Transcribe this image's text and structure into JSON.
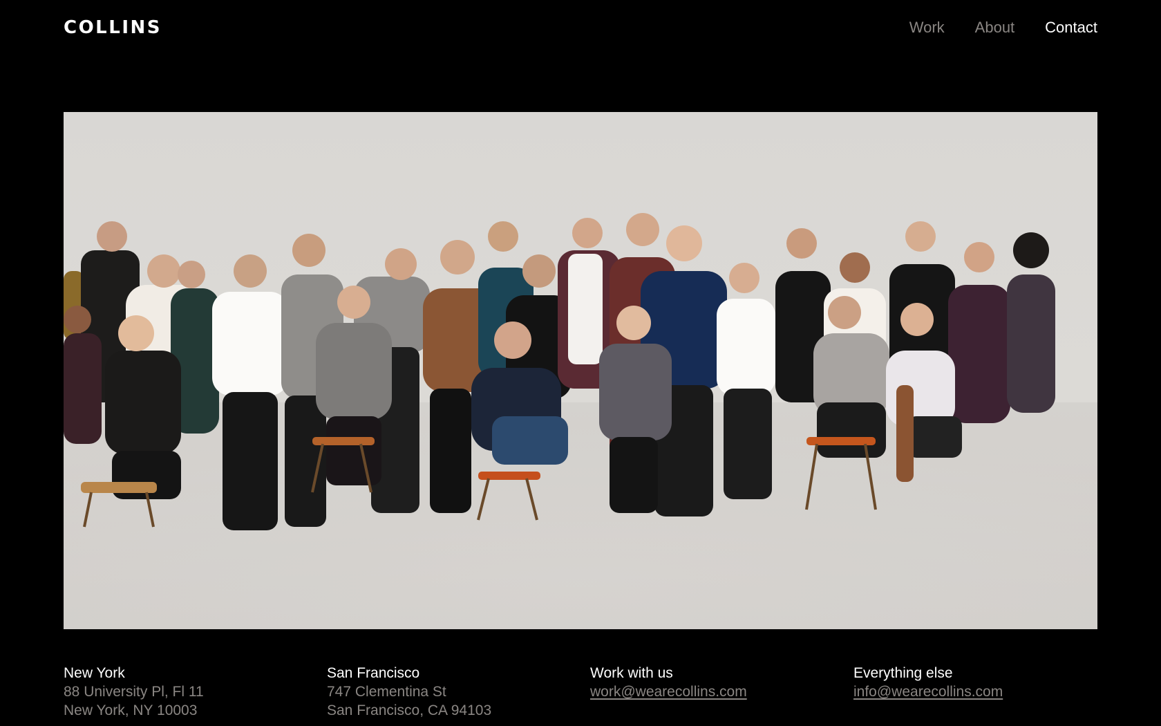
{
  "header": {
    "logo": "COLLINS",
    "nav": [
      {
        "label": "Work",
        "active": false
      },
      {
        "label": "About",
        "active": false
      },
      {
        "label": "Contact",
        "active": true
      }
    ]
  },
  "hero": {
    "background_color": "#d9d7d4"
  },
  "footer": {
    "columns": [
      {
        "heading": "New York",
        "lines": [
          "88 University Pl, Fl 11",
          "New York, NY 10003"
        ]
      },
      {
        "heading": "San Francisco",
        "lines": [
          "747 Clementina St",
          "San Francisco, CA 94103"
        ]
      },
      {
        "heading": "Work with us",
        "email": "work@wearecollins.com"
      },
      {
        "heading": "Everything else",
        "email": "info@wearecollins.com"
      }
    ]
  },
  "colors": {
    "background": "#000000",
    "text_primary": "#ffffff",
    "text_muted": "#8a8683"
  }
}
